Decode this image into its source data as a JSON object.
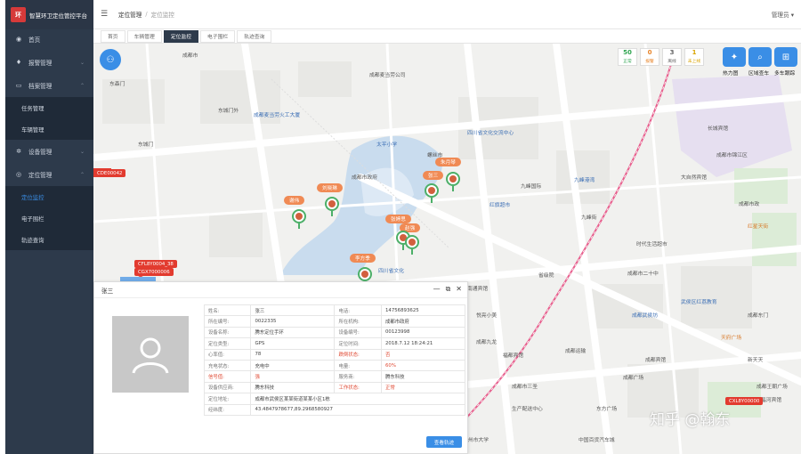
{
  "app": {
    "title": "智慧环卫定位管控平台",
    "logo_text": "环"
  },
  "sidebar": {
    "items": [
      {
        "label": "首页",
        "icon": "dashboard-icon"
      },
      {
        "label": "报警管理",
        "icon": "bell-icon"
      },
      {
        "label": "档案管理",
        "icon": "folder-icon"
      },
      {
        "label": "任务管理",
        "sub": true
      },
      {
        "label": "车辆管理",
        "sub": true
      },
      {
        "label": "设备管理",
        "icon": "gear-icon"
      },
      {
        "label": "定位管理",
        "icon": "location-icon"
      },
      {
        "label": "定位监控",
        "sub": true,
        "active": true
      },
      {
        "label": "电子围栏",
        "sub": true
      },
      {
        "label": "轨迹查询",
        "sub": true
      }
    ]
  },
  "topbar": {
    "breadcrumb1": "定位管理",
    "separator": "/",
    "breadcrumb2": "定位监控",
    "user": "管理员 ▾"
  },
  "tabs": [
    {
      "label": "首页"
    },
    {
      "label": "车辆管理"
    },
    {
      "label": "定位监控",
      "active": true
    },
    {
      "label": "电子围栏"
    },
    {
      "label": "轨迹查询"
    }
  ],
  "stats": [
    {
      "num": "50",
      "label": "正常",
      "color": "#2ea44f"
    },
    {
      "num": "0",
      "label": "报警",
      "color": "#e8862c"
    },
    {
      "num": "3",
      "label": "离线",
      "color": "#666666"
    },
    {
      "num": "1",
      "label": "未上线",
      "color": "#d9a300"
    }
  ],
  "map_tools": [
    {
      "label": "热力图",
      "icon": "heatmap-icon"
    },
    {
      "label": "区域查车",
      "icon": "area-search-icon"
    },
    {
      "label": "多车跟踪",
      "icon": "grid-icon"
    }
  ],
  "pins": [
    {
      "name": "张三"
    },
    {
      "name": "朱月琴"
    },
    {
      "name": "刘晓琳"
    },
    {
      "name": "谢伟"
    },
    {
      "name": "张婷思"
    },
    {
      "name": "赵强"
    },
    {
      "name": "李方季"
    }
  ],
  "cars": [
    {
      "plate": "CDE00042"
    },
    {
      "plate": "CFL8Y0004_38"
    },
    {
      "plate": "CGX7000006"
    },
    {
      "plate": "CXL8Y00000"
    }
  ],
  "map_labels": [
    "东森门",
    "东城门",
    "东城门外",
    "成都市",
    "成都麦当劳火工大厦",
    "成都麦当劳公司",
    "四川省文化交流中心",
    "太平小学",
    "螺丝市",
    "成都市政府",
    "红旗超市",
    "九峰国际",
    "九峰港湾",
    "九峰街",
    "时代生活超市",
    "成都市锦江区",
    "长城宾馆",
    "大自然宾馆",
    "红星天街",
    "成都市政",
    "武侯区红荔教育",
    "成都市二十中",
    "成都武侯坊",
    "天府广场",
    "成都东门",
    "南通宾馆",
    "成都运输",
    "成都广场",
    "成都宾馆",
    "四川省文化",
    "省级院",
    "悦亮小美",
    "东方广场",
    "福都宾馆",
    "成都市三圣",
    "生产配送中心",
    "郑州市大学",
    "中国百货汽车城",
    "新天天",
    "晶河宾馆",
    "成都王朝广场",
    "成都九龙"
  ],
  "watermark": "知乎 @翰东",
  "panel": {
    "title": "张三",
    "rows": [
      [
        {
          "k": "姓名:",
          "v": "张三"
        },
        {
          "k": "电话:",
          "v": "14756893625"
        }
      ],
      [
        {
          "k": "所在编号:",
          "v": "0022335"
        },
        {
          "k": "所在机构:",
          "v": "成都市政府"
        }
      ],
      [
        {
          "k": "设备名称:",
          "v": "腾东定位手环"
        },
        {
          "k": "设备编号:",
          "v": "00123998"
        }
      ],
      [
        {
          "k": "定位类型:",
          "v": "GPS"
        },
        {
          "k": "定位时间:",
          "v": "2018.7.12 18:24:21"
        }
      ],
      [
        {
          "k": "心率值:",
          "v": "78"
        },
        {
          "k": "跌倒状态:",
          "v": "否",
          "red": true
        }
      ],
      [
        {
          "k": "充电状态:",
          "v": "充电中"
        },
        {
          "k": "电量:",
          "v": "60%",
          "red": true
        }
      ],
      [
        {
          "k": "信号值:",
          "v": "强",
          "red": true
        },
        {
          "k": "服务商:",
          "v": "腾东科技"
        }
      ],
      [
        {
          "k": "设备供应商:",
          "v": "腾东科技"
        },
        {
          "k": "工作状态:",
          "v": "正常",
          "red": true
        }
      ],
      [
        {
          "k": "定位地址:",
          "v": "成都市武侯区某某街道某某小区1栋"
        }
      ],
      [
        {
          "k": "经纬度:",
          "v": "43.4847978677,89.2968580927"
        }
      ]
    ],
    "button": "查看轨迹"
  }
}
